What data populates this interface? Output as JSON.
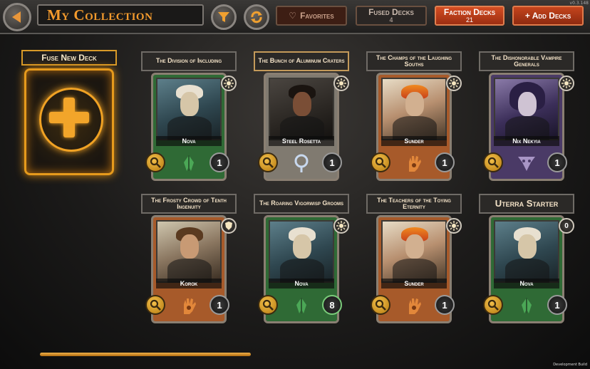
{
  "header": {
    "title": "My Collection",
    "version": "v0.3.148",
    "tabs": {
      "favorites": {
        "label": "Favorites"
      },
      "fused": {
        "label": "Fused Decks",
        "count": "4"
      },
      "faction": {
        "label": "Faction Decks",
        "count": "21"
      },
      "add": {
        "label": "+ Add Decks"
      }
    }
  },
  "fuse": {
    "label": "Fuse New Deck"
  },
  "decks": [
    {
      "title": "The Division of Including",
      "character": "Nova",
      "faction": "green",
      "count": "1",
      "gem": "sun"
    },
    {
      "title": "The Bunch of Aluminum Craters",
      "character": "Steel Rosetta",
      "faction": "gray",
      "count": "1",
      "gem": "sun"
    },
    {
      "title": "The Champs of the Laughing Souths",
      "character": "Sunder",
      "faction": "orange",
      "count": "1",
      "gem": "sun"
    },
    {
      "title": "The Dishonorable Vampire Generals",
      "character": "Nix Nekyia",
      "faction": "purple",
      "count": "1",
      "gem": "sun"
    },
    {
      "title": "The Frosty Crowd of Tenth Ingenuity",
      "character": "Korok",
      "faction": "orange",
      "count": "1",
      "gem": "shield"
    },
    {
      "title": "The Roaring Vigorwisp Grooms",
      "character": "Nova",
      "faction": "green",
      "count": "8",
      "gem": "sun"
    },
    {
      "title": "The Teachers of the Toying Eternity",
      "character": "Sunder",
      "faction": "orange",
      "count": "1",
      "gem": "sun"
    },
    {
      "title": "Uterra Starter",
      "character": "Nova",
      "faction": "green",
      "count": "1",
      "gem": "0"
    }
  ],
  "footer": {
    "build_label": "Development Build"
  },
  "colors": {
    "accent": "#f39a2d",
    "faction_tab": "#c4441c",
    "green_faction": "#2f6a35",
    "orange_faction": "#a75a2a",
    "purple_faction": "#4a3a66"
  }
}
